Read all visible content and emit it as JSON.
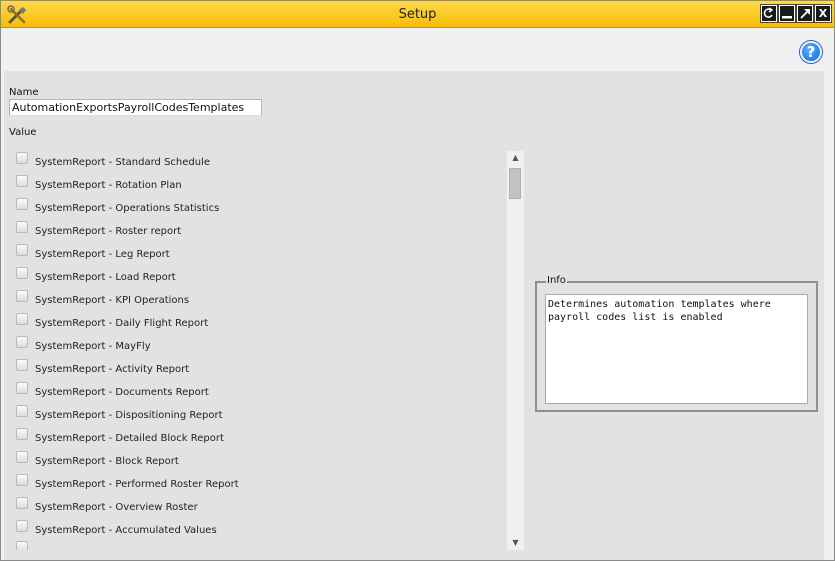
{
  "window": {
    "title": "Setup",
    "accent": "#f7bd07",
    "icons": [
      "tools-icon",
      "restore-icon",
      "minimize-icon",
      "maximize-icon",
      "close-icon"
    ],
    "close_label": "X"
  },
  "toolbar": {
    "help_label": "?"
  },
  "form": {
    "name_label": "Name",
    "name_value": "AutomationExportsPayrollCodesTemplates",
    "value_label": "Value",
    "items": [
      {
        "label": "SystemReport - Standard Schedule",
        "checked": false
      },
      {
        "label": "SystemReport - Rotation Plan",
        "checked": false
      },
      {
        "label": "SystemReport - Operations Statistics",
        "checked": false
      },
      {
        "label": "SystemReport - Roster report",
        "checked": false
      },
      {
        "label": "SystemReport - Leg Report",
        "checked": false
      },
      {
        "label": "SystemReport - Load Report",
        "checked": false
      },
      {
        "label": "SystemReport - KPI Operations",
        "checked": false
      },
      {
        "label": "SystemReport - Daily Flight Report",
        "checked": false
      },
      {
        "label": "SystemReport - MayFly",
        "checked": false
      },
      {
        "label": "SystemReport - Activity Report",
        "checked": false
      },
      {
        "label": "SystemReport - Documents Report",
        "checked": false
      },
      {
        "label": "SystemReport - Dispositioning Report",
        "checked": false
      },
      {
        "label": "SystemReport - Detailed Block Report",
        "checked": false
      },
      {
        "label": "SystemReport - Block Report",
        "checked": false
      },
      {
        "label": "SystemReport - Performed Roster Report",
        "checked": false
      },
      {
        "label": "SystemReport - Overview Roster",
        "checked": false
      },
      {
        "label": "SystemReport - Accumulated Values",
        "checked": false
      }
    ]
  },
  "info": {
    "legend": "Info",
    "text": "Determines automation templates where\npayroll codes list is enabled"
  }
}
